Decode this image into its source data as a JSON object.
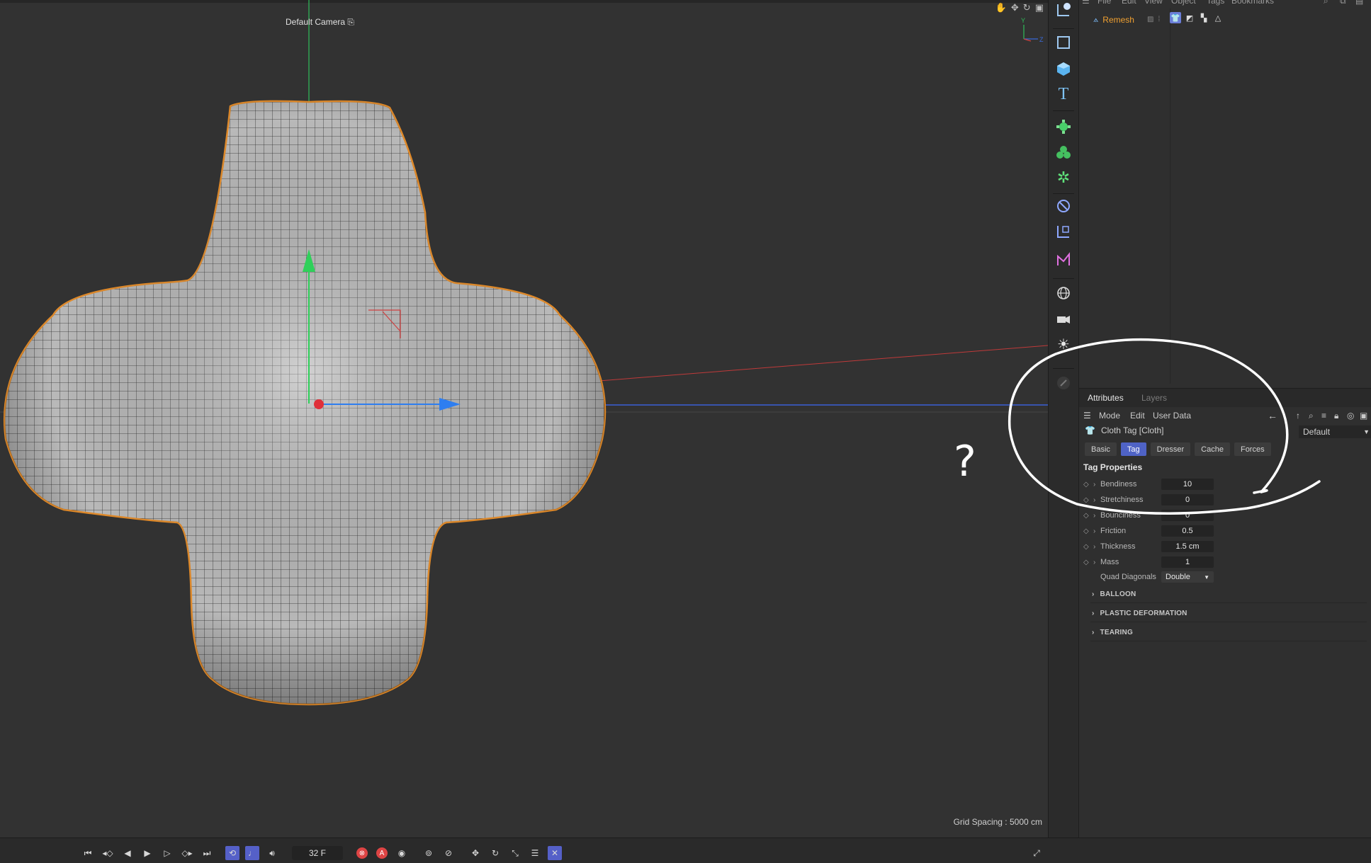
{
  "viewport": {
    "camera_label": "Default Camera",
    "grid_spacing": "Grid Spacing : 5000 cm",
    "axis_labels": {
      "y": "Y",
      "z": "Z"
    }
  },
  "object_manager": {
    "menu": [
      "File",
      "Edit",
      "View",
      "Object",
      "Tags",
      "Bookmarks"
    ],
    "object_name": "Remesh"
  },
  "attributes": {
    "tabs": [
      "Attributes",
      "Layers"
    ],
    "menubar": [
      "Mode",
      "Edit",
      "User Data"
    ],
    "title": "Cloth Tag [Cloth]",
    "preset": "Default",
    "subtabs": [
      "Basic",
      "Tag",
      "Dresser",
      "Cache",
      "Forces"
    ],
    "active_subtab": "Tag",
    "section": "Tag Properties",
    "properties": [
      {
        "label": "Bendiness",
        "value": "10"
      },
      {
        "label": "Stretchiness",
        "value": "0"
      },
      {
        "label": "Bounciness",
        "value": "0"
      },
      {
        "label": "Friction",
        "value": "0.5"
      },
      {
        "label": "Thickness",
        "value": "1.5 cm"
      },
      {
        "label": "Mass",
        "value": "1"
      }
    ],
    "quad_diagonals": {
      "label": "Quad Diagonals",
      "value": "Double"
    },
    "groups": [
      "BALLOON",
      "PLASTIC DEFORMATION",
      "TEARING"
    ]
  },
  "timeline": {
    "current_frame": "32 F"
  },
  "annotation": {
    "text": "?"
  },
  "colors": {
    "selection_orange": "#e08a2a",
    "axis_green": "#2fd05a",
    "axis_blue": "#2e7ef0",
    "axis_red": "#e0303a",
    "active_tab": "#4f63c6"
  }
}
